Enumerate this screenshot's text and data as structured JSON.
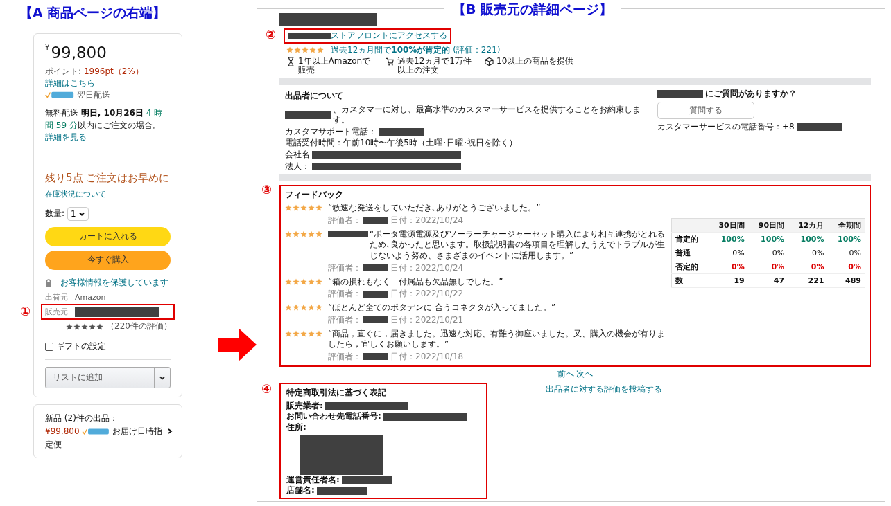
{
  "panel_a": {
    "heading": "【A 商品ページの右端】",
    "price_symbol": "¥",
    "price": "99,800",
    "points_label": "ポイント:",
    "points_value": "1996pt（2%）",
    "points_link": "詳細はこちら",
    "prime_delivery": "翌日配送",
    "delivery": [
      {
        "kind": "plain",
        "text": "無料配送 "
      },
      {
        "kind": "bold",
        "text": "明日, 10月26日"
      },
      {
        "kind": "countdown",
        "text": " 4 時間 59 分"
      },
      {
        "kind": "plain",
        "text": "以内にご注文の場合。"
      }
    ],
    "delivery_link": "詳細を見る",
    "stock": "残り5点 ご注文はお早めに",
    "stock_link": "在庫状況について",
    "quantity_label": "数量:",
    "quantity": "1",
    "buttons": [
      {
        "kind": "cart",
        "label": "カートに入れる"
      },
      {
        "kind": "buy",
        "label": "今すぐ購入"
      }
    ],
    "secure": "お客様情報を保護しています",
    "ships_from_label": "出荷元",
    "ships_from": "Amazon",
    "sold_by_marker": "①",
    "sold_by_label": "販売元",
    "seller_rating": {
      "stars": 5,
      "count": "（220件の評価）"
    },
    "gift": {
      "label": "ギフトの設定",
      "checked": false
    },
    "list_button": "リストに追加",
    "offers": {
      "text": "新品 (2)件の出品：",
      "price": "¥99,800",
      "delivery": "お届け日時指定便"
    }
  },
  "panel_b": {
    "heading": "【B 販売元の詳細ページ】",
    "storefront_marker": "②",
    "storefront_link": "ストアフロントにアクセスする",
    "stars": 5,
    "rating_summary": "過去12ヵ月間で**100%が肯定的** (評価：221)",
    "badges": [
      {
        "kind": "hourglass",
        "text": "1年以上Amazonで販売"
      },
      {
        "kind": "cart",
        "text": "過去12ヵ月で1万件以上の注文"
      },
      {
        "kind": "box",
        "text": "10以上の商品を提供"
      }
    ],
    "about": {
      "title": "出品者について",
      "pledge": "、カスタマーに対し、最高水準のカスタマーサービスを提供することをお約束します。",
      "support_phone_label": "カスタマサポート電話：",
      "hours": "電話受付時間：午前10時〜午後5時（土曜･日曜･祝日を除く）",
      "company_label": "会社名",
      "corporation_label": "法人："
    },
    "question": {
      "title": "にご質問がありますか？",
      "button": "質問する",
      "phone_label": "カスタマーサービスの電話番号：+8"
    },
    "feedback": {
      "marker": "③",
      "title": "フィードバック",
      "reviews": [
        {
          "kind": "plain",
          "stars": 5,
          "text": "“敏速な発送をしていただき､ありがとうございました。”",
          "reviewer_label": "評価者：",
          "date": "日付：2022/10/24"
        },
        {
          "stars": 5,
          "text": "“ポータ電源電源及びソーラーチャージャーセット購入により相互連携がとれるため､良かったと思います。取扱説明書の各項目を理解したうえでトラブルが生じないよう努め、さまざまのイベントに活用します。”",
          "kind": "redacted_lead",
          "reviewer_label": "評価者：",
          "date": "日付：2022/10/24"
        },
        {
          "kind": "plain",
          "stars": 5,
          "text": "“箱の損れもなく　付属品も欠品無しでした。”",
          "reviewer_label": "評価者：",
          "date": "日付：2022/10/22"
        },
        {
          "kind": "plain",
          "stars": 5,
          "text": "“ほとんど全てのポタデンに 合うコネクタが入ってました。”",
          "reviewer_label": "評価者：",
          "date": "日付：2022/10/21"
        },
        {
          "kind": "plain",
          "stars": 5,
          "text": "“商品，直ぐに，届きました。迅速な対応、有難う御座いました。又、購入の機会が有りましたら，宜しくお願いします。”",
          "reviewer_label": "評価者：",
          "date": "日付：2022/10/18"
        }
      ],
      "table": {
        "columns": [
          "30日間",
          "90日間",
          "12カ月",
          "全期間"
        ],
        "rows": [
          {
            "kind": "positive",
            "label": "肯定的",
            "values": [
              "100%",
              "100%",
              "100%",
              "100%"
            ]
          },
          {
            "kind": "neutral",
            "label": "普通",
            "values": [
              "0%",
              "0%",
              "0%",
              "0%"
            ]
          },
          {
            "kind": "negative",
            "label": "否定的",
            "values": [
              "0%",
              "0%",
              "0%",
              "0%"
            ]
          },
          {
            "kind": "count",
            "label": "数",
            "values": [
              "19",
              "47",
              "221",
              "489"
            ]
          }
        ]
      },
      "pager": [
        "前へ",
        "次へ"
      ]
    },
    "post_link": "出品者に対する評価を投稿する",
    "law": {
      "marker": "④",
      "title": "特定商取引法に基づく表記",
      "fields": [
        {
          "kind": "line",
          "label": "販売業者:"
        },
        {
          "kind": "line",
          "label": "お問い合わせ先電話番号:"
        },
        {
          "kind": "block",
          "label": "住所:"
        },
        {
          "kind": "short",
          "label": "運営責任者名:"
        },
        {
          "kind": "short",
          "label": "店舗名:"
        }
      ]
    }
  }
}
